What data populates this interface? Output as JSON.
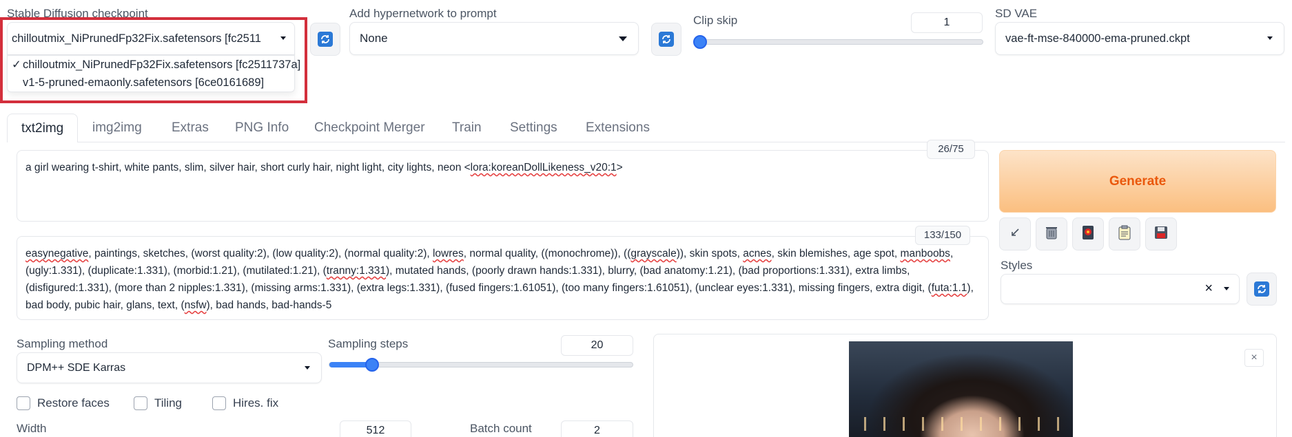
{
  "checkpoint": {
    "label": "Stable Diffusion checkpoint",
    "selected": "chilloutmix_NiPrunedFp32Fix.safetensors [fc2511",
    "options": [
      "chilloutmix_NiPrunedFp32Fix.safetensors [fc2511737a]",
      "v1-5-pruned-emaonly.safetensors [6ce0161689]"
    ],
    "checkmark": "✓"
  },
  "hypernetwork": {
    "label": "Add hypernetwork to prompt",
    "selected": "None"
  },
  "clip_skip": {
    "label": "Clip skip",
    "value": "1",
    "fraction": 0.0
  },
  "sd_vae": {
    "label": "SD VAE",
    "selected": "vae-ft-mse-840000-ema-pruned.ckpt"
  },
  "tabs": [
    "txt2img",
    "img2img",
    "Extras",
    "PNG Info",
    "Checkpoint Merger",
    "Train",
    "Settings",
    "Extensions"
  ],
  "prompt": {
    "counter": "26/75",
    "text_before": "a girl wearing t-shirt, white pants, slim, silver hair, short curly hair, night light, city lights, neon <",
    "text_underlined": "lora:koreanDollLikeness_v20:1",
    "text_after": ">"
  },
  "negative_prompt": {
    "counter": "133/150",
    "text": "easynegative, paintings, sketches, (worst quality:2), (low quality:2), (normal quality:2), lowres, normal quality, ((monochrome)), ((grayscale)), skin spots, acnes, skin blemishes, age spot, manboobs, (ugly:1.331), (duplicate:1.331), (morbid:1.21), (mutilated:1.21), (tranny:1.331), mutated hands, (poorly drawn hands:1.331), blurry, (bad anatomy:1.21), (bad proportions:1.331), extra limbs, (disfigured:1.331), (more than 2 nipples:1.331), (missing arms:1.331), (extra legs:1.331), (fused fingers:1.61051), (too many fingers:1.61051), (unclear eyes:1.331), missing fingers, extra digit, (futa:1.1), bad body, pubic hair, glans, text, (nsfw), bad hands, bad-hands-5"
  },
  "generate_label": "Generate",
  "tool_icons": [
    "arrow-icon",
    "trash-icon",
    "card-icon",
    "clipboard-icon",
    "save-icon"
  ],
  "styles": {
    "label": "Styles",
    "clear": "×"
  },
  "sampling_method": {
    "label": "Sampling method",
    "selected": "DPM++ SDE Karras"
  },
  "sampling_steps": {
    "label": "Sampling steps",
    "value": "20",
    "fraction": 0.14
  },
  "checkboxes": [
    {
      "label": "Restore faces",
      "checked": false
    },
    {
      "label": "Tiling",
      "checked": false
    },
    {
      "label": "Hires. fix",
      "checked": false
    }
  ],
  "width": {
    "label": "Width",
    "value": "512"
  },
  "batch_count": {
    "label": "Batch count",
    "value": "2"
  },
  "image_close": "×",
  "colors": {
    "accent": "#3b82f6",
    "generate_text": "#ea580c",
    "highlight": "#d32f3c"
  }
}
